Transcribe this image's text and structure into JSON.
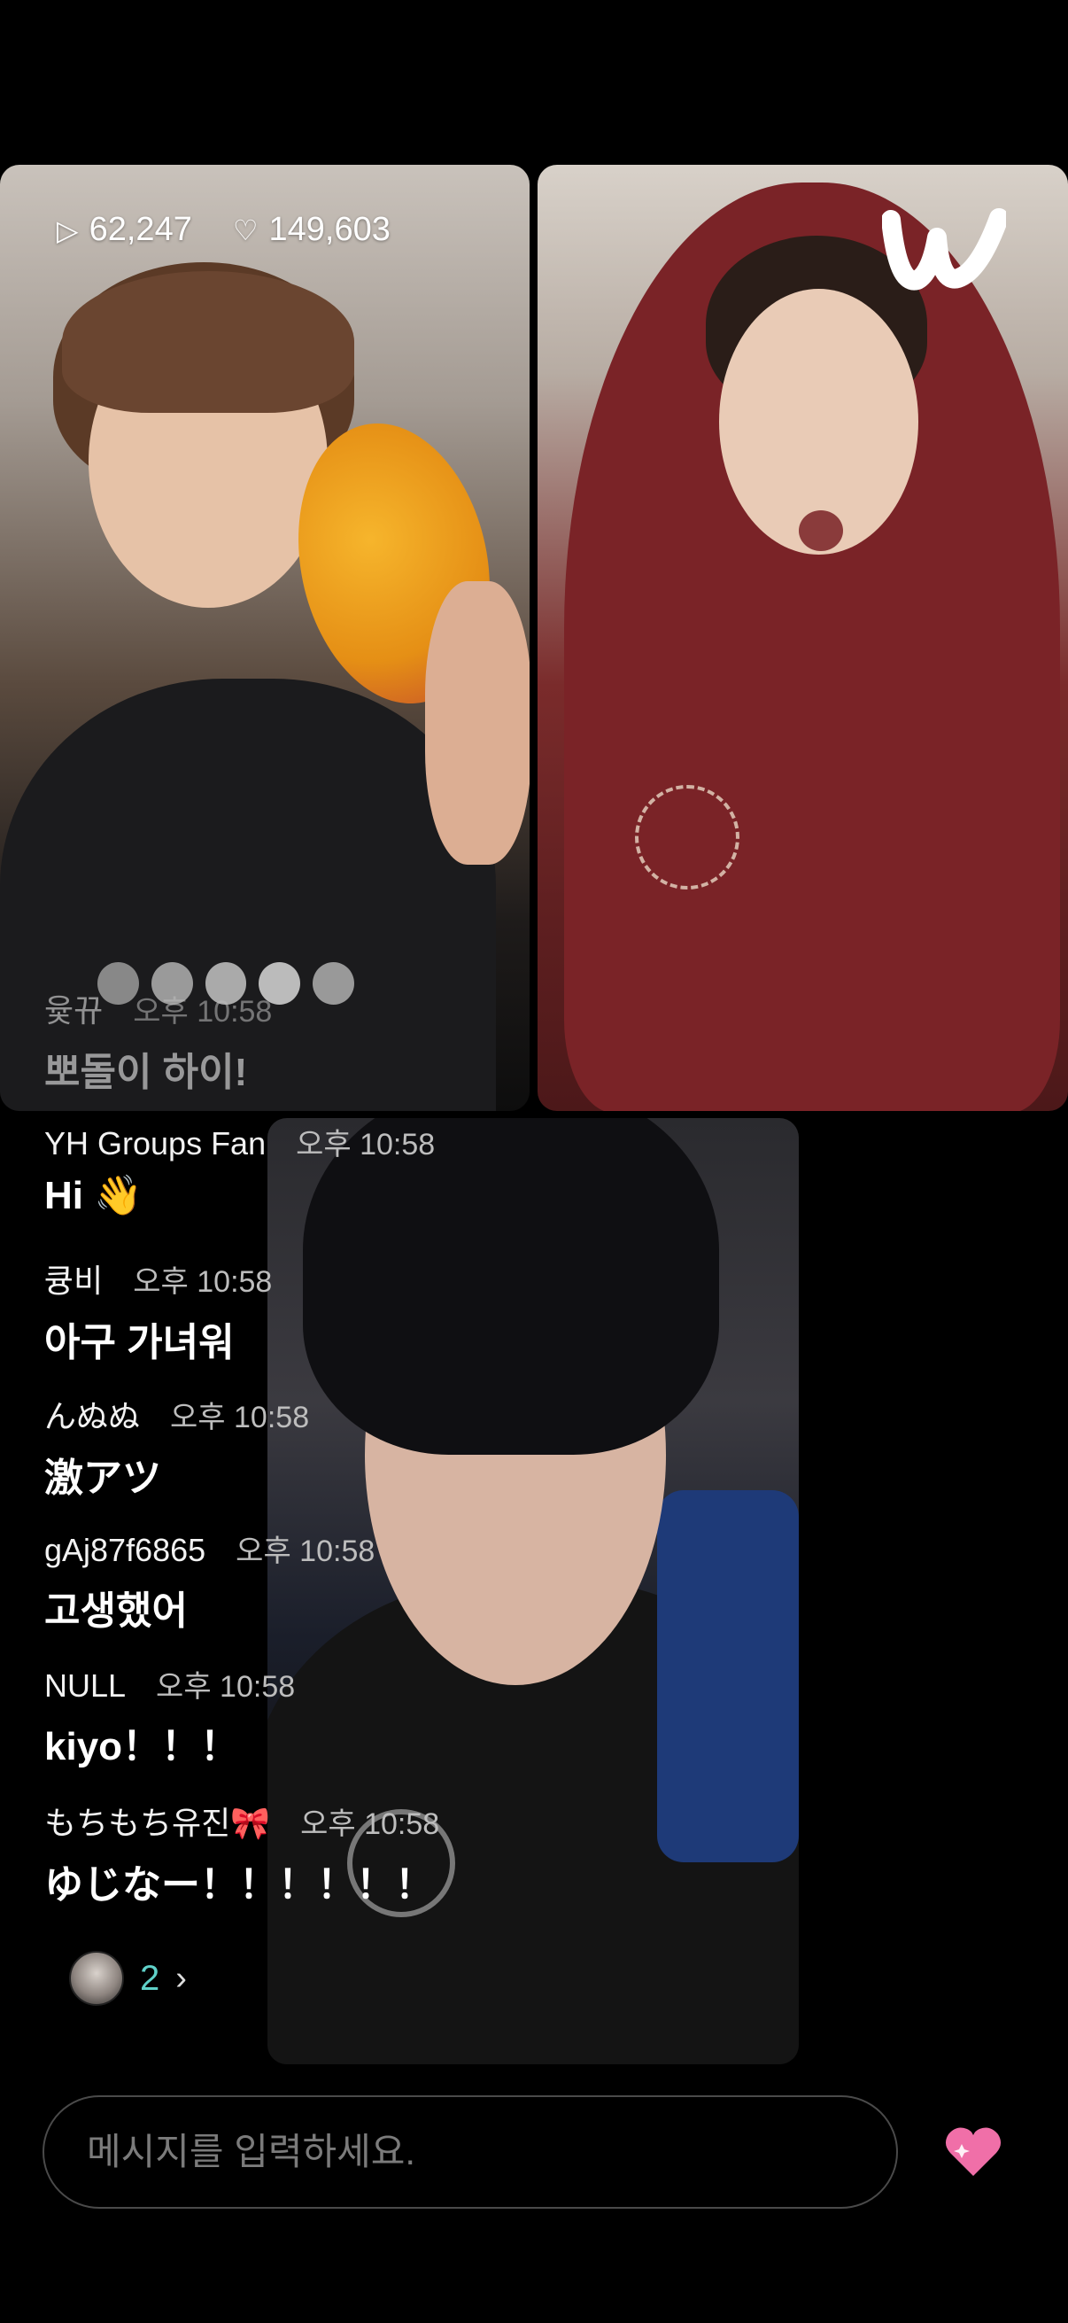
{
  "stats": {
    "plays": "62,247",
    "likes": "149,603",
    "play_icon": "play-icon",
    "heart_icon": "heart-outline-icon"
  },
  "overlay_chat": {
    "user": "윷뀨",
    "time": "오후 10:58",
    "message": "뽀돌이 하이!"
  },
  "chats": [
    {
      "user": "YH Groups Fan",
      "time": "오후 10:58",
      "message": "Hi 👋"
    },
    {
      "user": "큥비",
      "time": "오후 10:58",
      "message": "아구 가녀워"
    },
    {
      "user": "んぬぬ",
      "time": "오후 10:58",
      "message": "激アツ"
    },
    {
      "user": "gAj87f6865",
      "time": "오후 10:58",
      "message": "고생했어"
    },
    {
      "user": "NULL",
      "time": "오후 10:58",
      "message": "kiyo！！！"
    },
    {
      "user": "もちもち유진🎀",
      "time": "오후 10:58",
      "message": "ゆじなー！！！！！！"
    }
  ],
  "viewers": {
    "count": "2",
    "chevron": "›"
  },
  "input": {
    "placeholder": "메시지를 입력하세요."
  },
  "colors": {
    "accent": "#5fd0c8",
    "heart": "#f06fa8"
  }
}
